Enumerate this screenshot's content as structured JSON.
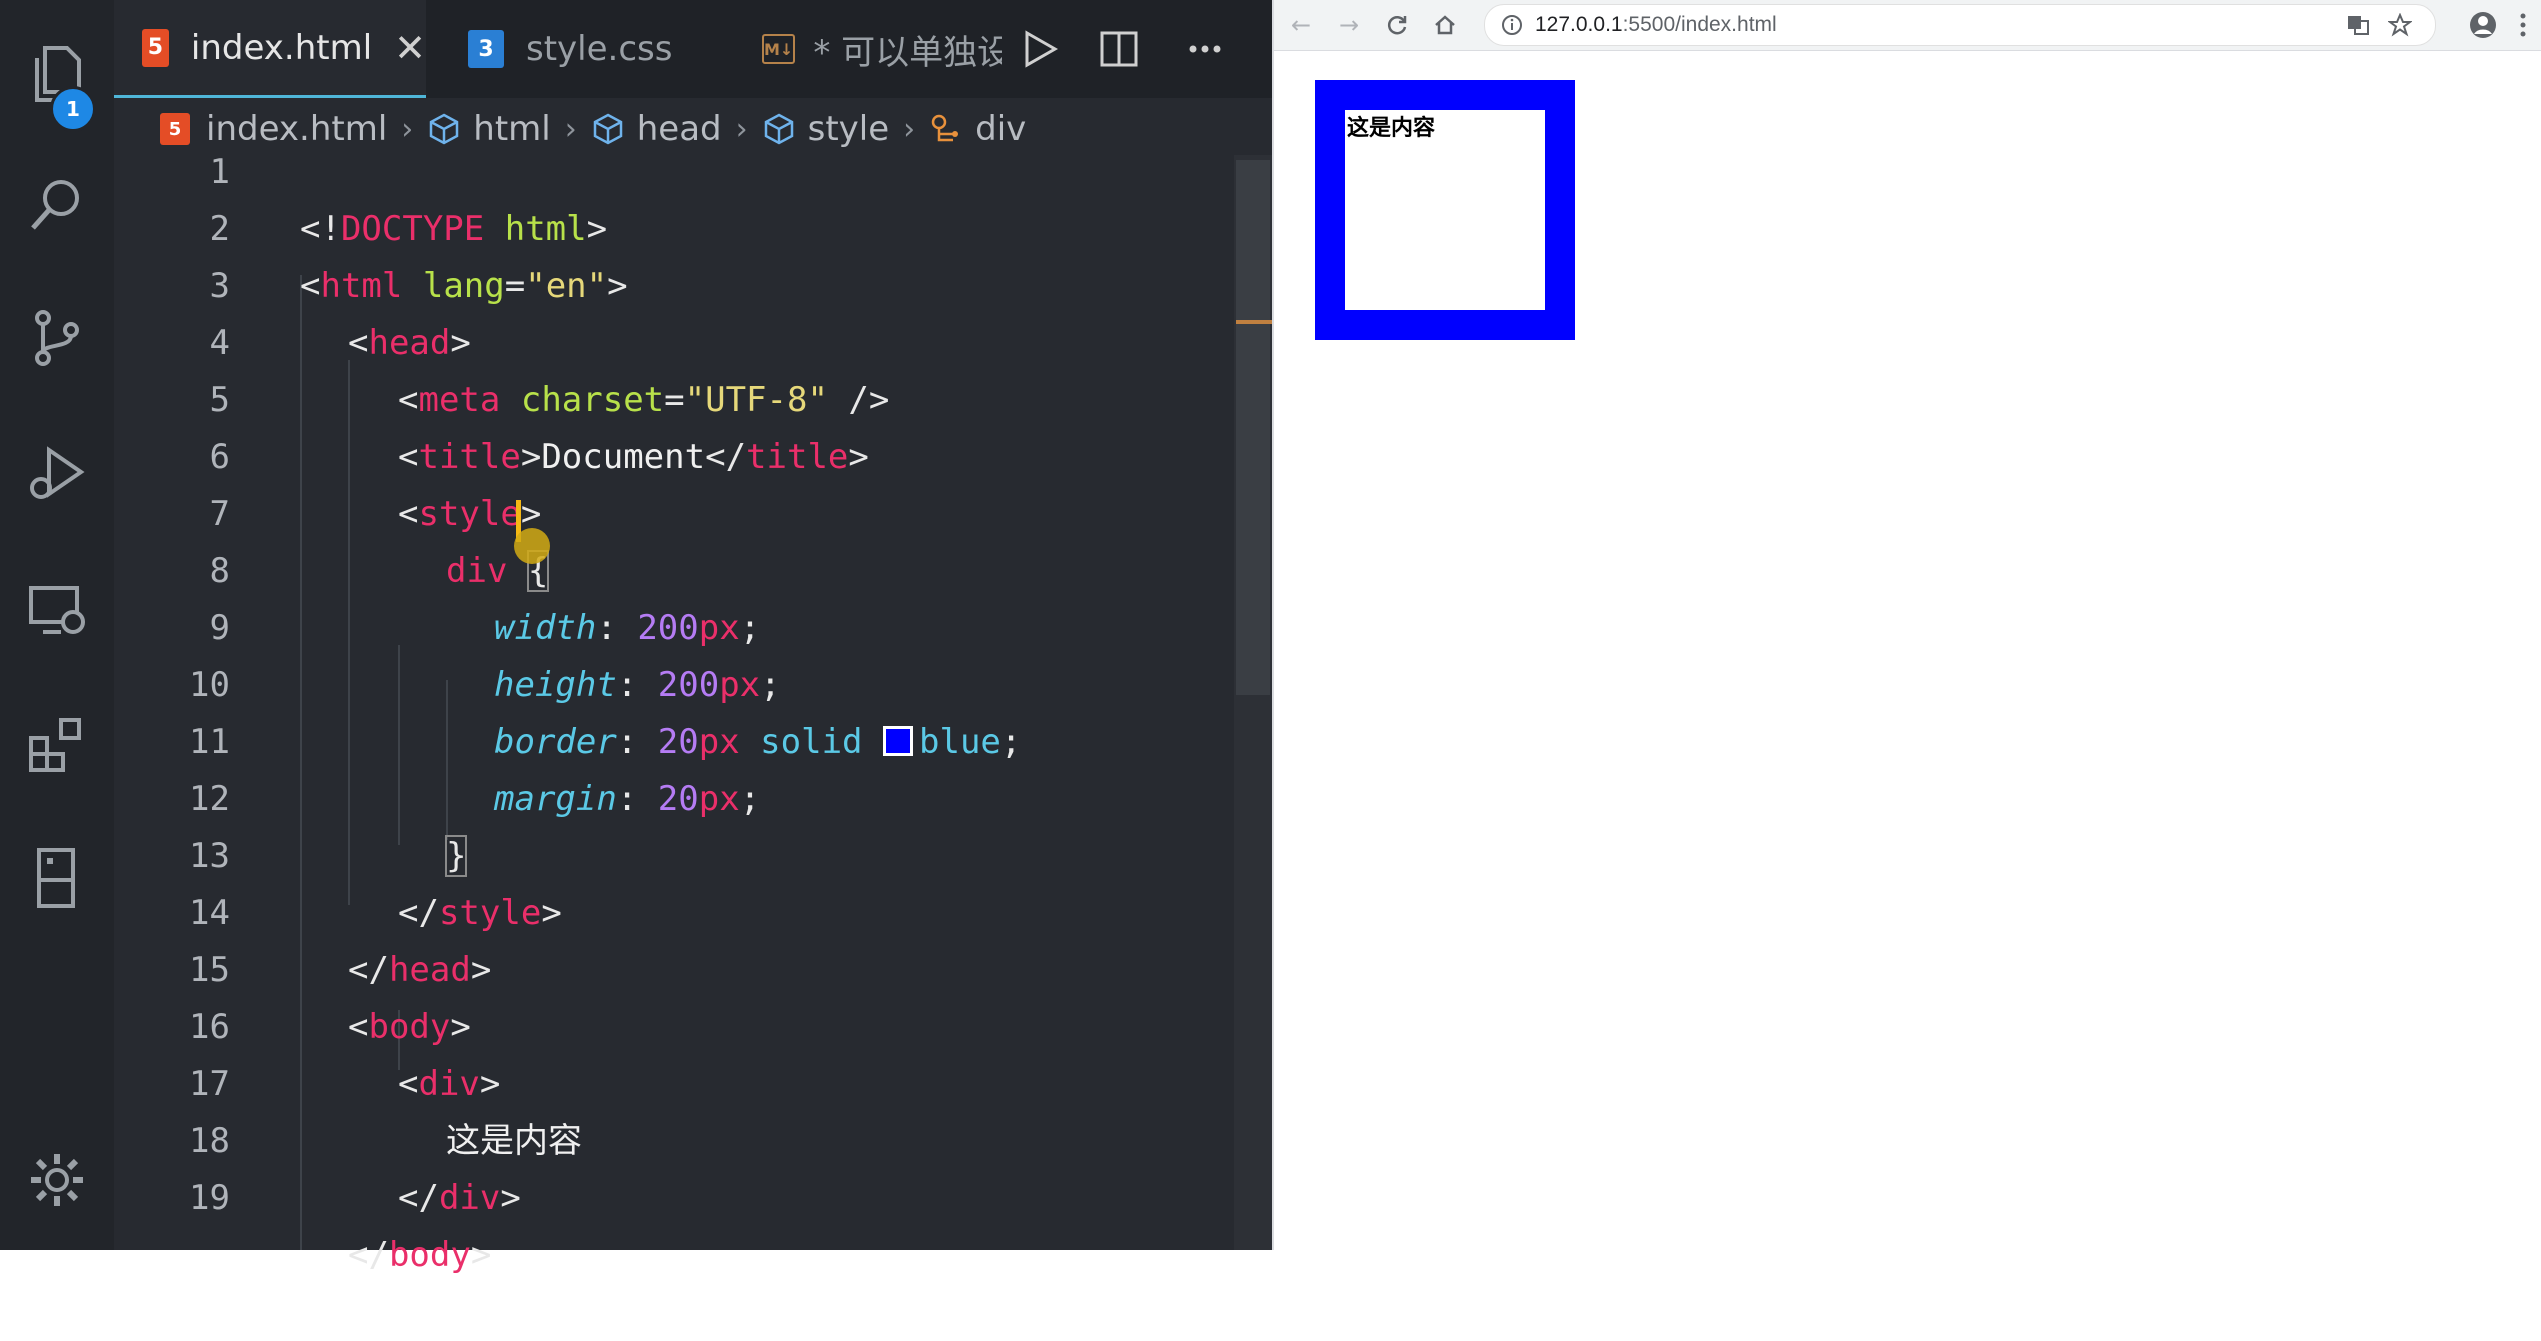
{
  "editor": {
    "tabs": [
      {
        "label": "index.html",
        "icon": "html5-icon",
        "active": true
      },
      {
        "label": "style.css",
        "icon": "css3-icon",
        "active": false
      },
      {
        "label": "* 可以单独设",
        "icon": "markdown-icon",
        "active": false
      }
    ],
    "notification_badge": "1",
    "icon_labels": {
      "html_icon": "5",
      "css_icon": "3",
      "markdown_icon": "M↓"
    },
    "breadcrumb": [
      "index.html",
      "html",
      "head",
      "style",
      "div"
    ],
    "lines": [
      {
        "n": "1"
      },
      {
        "n": "2"
      },
      {
        "n": "3"
      },
      {
        "n": "4"
      },
      {
        "n": "5"
      },
      {
        "n": "6"
      },
      {
        "n": "7"
      },
      {
        "n": "8"
      },
      {
        "n": "9"
      },
      {
        "n": "10"
      },
      {
        "n": "11"
      },
      {
        "n": "12"
      },
      {
        "n": "13"
      },
      {
        "n": "14"
      },
      {
        "n": "15"
      },
      {
        "n": "16"
      },
      {
        "n": "17"
      },
      {
        "n": "18"
      },
      {
        "n": "19"
      }
    ],
    "code": {
      "doctype_open": "<!",
      "doctype_kw": "DOCTYPE",
      "doctype_html": "html",
      "lt": "<",
      "gt": ">",
      "lt_slash": "</",
      "self_close": " />",
      "html_tag": "html",
      "lang_attr": "lang",
      "eq": "=",
      "lang_val": "\"en\"",
      "head_tag": "head",
      "meta_tag": "meta",
      "charset_attr": "charset",
      "charset_val": "\"UTF-8\"",
      "title_tag": "title",
      "title_text": "Document",
      "style_tag": "style",
      "div_sel": "div",
      "open_brace": "{",
      "close_brace": "}",
      "width_prop": "width",
      "height_prop": "height",
      "border_prop": "border",
      "margin_prop": "margin",
      "colon": ": ",
      "semicolon": ";",
      "val_200": "200",
      "val_20": "20",
      "unit_px": "px",
      "kw_solid": "solid",
      "kw_blue": "blue",
      "body_tag": "body",
      "div_tag": "div",
      "content_text": "这是内容"
    }
  },
  "browser": {
    "url_host": "127.0.0.1",
    "url_path": ":5500/index.html",
    "page_content": "这是内容",
    "box_border_color": "#0000ff"
  },
  "colors": {
    "editor_bg": "#272a30",
    "activity_bar_bg": "#22252a",
    "tag": "#ea2f6a",
    "attr": "#b8e14a",
    "string": "#e6d87a",
    "property": "#5bc9e6",
    "number": "#b57cf4",
    "accent": "#4fb6d8"
  }
}
